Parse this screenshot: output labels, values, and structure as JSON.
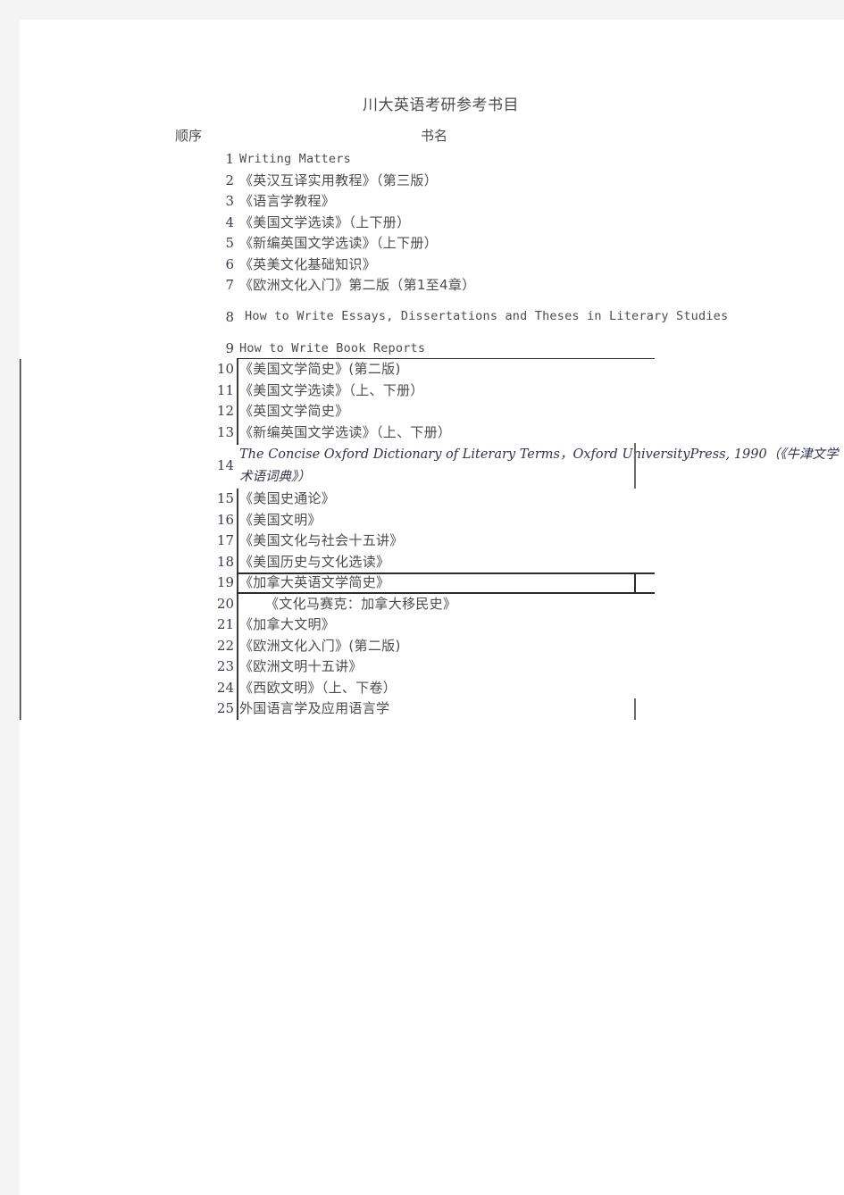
{
  "document": {
    "title": "川大英语考研参考书目"
  },
  "table": {
    "headers": {
      "sequence": "顺序",
      "book_title": "书名"
    },
    "rows": [
      {
        "no": "1",
        "name": "Writing Matters",
        "script": "latin"
      },
      {
        "no": "2",
        "name": "《英汉互译实用教程》（第三版）",
        "script": "cjk"
      },
      {
        "no": "3",
        "name": "《语言学教程》",
        "script": "cjk"
      },
      {
        "no": "4",
        "name": "《美国文学选读》（上下册）",
        "script": "cjk"
      },
      {
        "no": "5",
        "name": "《新编英国文学选读》（上下册）",
        "script": "cjk"
      },
      {
        "no": "6",
        "name": "《英美文化基础知识》",
        "script": "cjk"
      },
      {
        "no": "7",
        "name": "《欧洲文化入门》第二版（第1至4章）",
        "script": "cjk"
      },
      {
        "no": "8",
        "name": "How to Write Essays, Dissertations and Theses in Literary Studies",
        "script": "latin"
      },
      {
        "no": "9",
        "name": "How to Write Book Reports",
        "script": "latin"
      },
      {
        "no": "10",
        "name": "《美国文学简史》(第二版)",
        "script": "cjk"
      },
      {
        "no": "11",
        "name": "《美国文学选读》（上、下册）",
        "script": "cjk"
      },
      {
        "no": "12",
        "name": "《英国文学简史》",
        "script": "cjk"
      },
      {
        "no": "13",
        "name": "《新编英国文学选读》（上、下册）",
        "script": "cjk"
      },
      {
        "no": "14",
        "name": "The Concise Oxford Dictionary of Literary Terms，Oxford  UniversityPress, 1990（《牛津文学术语词典》）",
        "script": "italic"
      },
      {
        "no": "15",
        "name": "《美国史通论》",
        "script": "cjk"
      },
      {
        "no": "16",
        "name": "《美国文明》",
        "script": "cjk"
      },
      {
        "no": "17",
        "name": "《美国文化与社会十五讲》",
        "script": "cjk"
      },
      {
        "no": "18",
        "name": "《美国历史与文化选读》",
        "script": "cjk"
      },
      {
        "no": "19",
        "name": "《加拿大英语文学简史》",
        "script": "cjk"
      },
      {
        "no": "20",
        "name": "《文化马赛克：加拿大移民史》",
        "script": "cjk"
      },
      {
        "no": "21",
        "name": "《加拿大文明》",
        "script": "cjk"
      },
      {
        "no": "22",
        "name": "《欧洲文化入门》(第二版)",
        "script": "cjk"
      },
      {
        "no": "23",
        "name": "《欧洲文明十五讲》",
        "script": "cjk"
      },
      {
        "no": "24",
        "name": "《西欧文明》（上、下卷）",
        "script": "cjk"
      },
      {
        "no": "25",
        "name": "外国语言学及应用语言学",
        "script": "cjk"
      }
    ]
  },
  "colors": {
    "page_background": "#f4f4f4",
    "sheet": "#ffffff",
    "text": "#4c4c4c",
    "number_text": "#3a3a52",
    "rule": "#2b2b2b",
    "rule_light": "#6b6b6b"
  }
}
